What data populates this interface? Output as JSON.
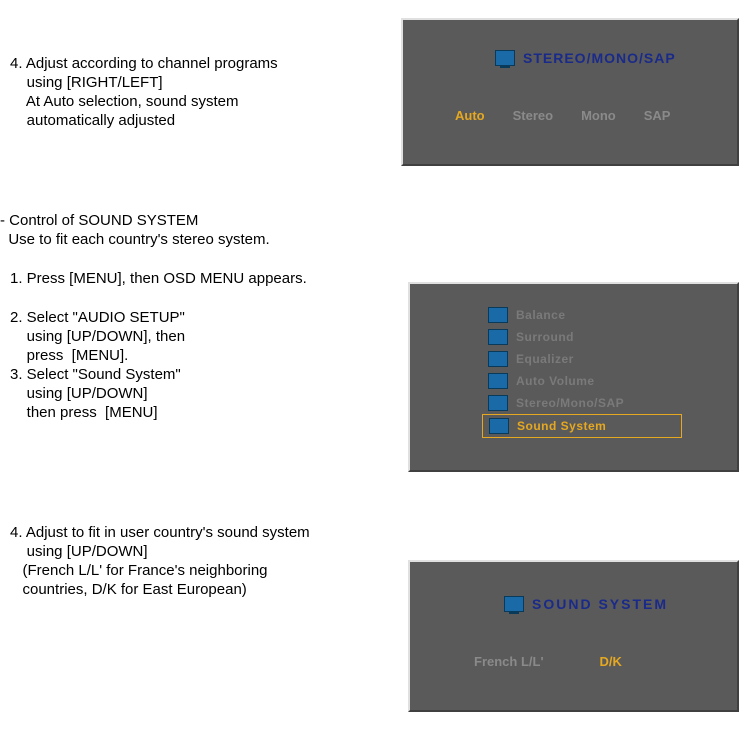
{
  "instructions": {
    "block1_l1": "4. Adjust according to channel programs",
    "block1_l2": "    using [RIGHT/LEFT]",
    "block1_l3": "    At Auto selection, sound system",
    "block1_l4": "    automatically adjusted",
    "block2_l1": "- Control of SOUND SYSTEM",
    "block2_l2": "  Use to fit each country's stereo system.",
    "block3_l1": "1. Press [MENU], then OSD MENU appears.",
    "block4_l1": "2. Select \"AUDIO SETUP\"",
    "block4_l2": "    using [UP/DOWN], then",
    "block4_l3": "    press  [MENU].",
    "block4_l4": "3. Select \"Sound System\"",
    "block4_l5": "    using [UP/DOWN]",
    "block4_l6": "    then press  [MENU]",
    "block5_l1": "4. Adjust to fit in user country's sound system",
    "block5_l2": "    using [UP/DOWN]",
    "block5_l3": "   (French L/L' for France's neighboring",
    "block5_l4": "   countries, D/K for East European)"
  },
  "panel1": {
    "title": "STEREO/MONO/SAP",
    "options": {
      "auto": "Auto",
      "stereo": "Stereo",
      "mono": "Mono",
      "sap": "SAP"
    }
  },
  "panel2": {
    "items": [
      {
        "label": "Balance"
      },
      {
        "label": "Surround"
      },
      {
        "label": "Equalizer"
      },
      {
        "label": "Auto Volume"
      },
      {
        "label": "Stereo/Mono/SAP"
      },
      {
        "label": "Sound System"
      }
    ]
  },
  "panel3": {
    "title": "SOUND  SYSTEM",
    "options": {
      "french": "French L/L'",
      "dk": "D/K"
    }
  }
}
